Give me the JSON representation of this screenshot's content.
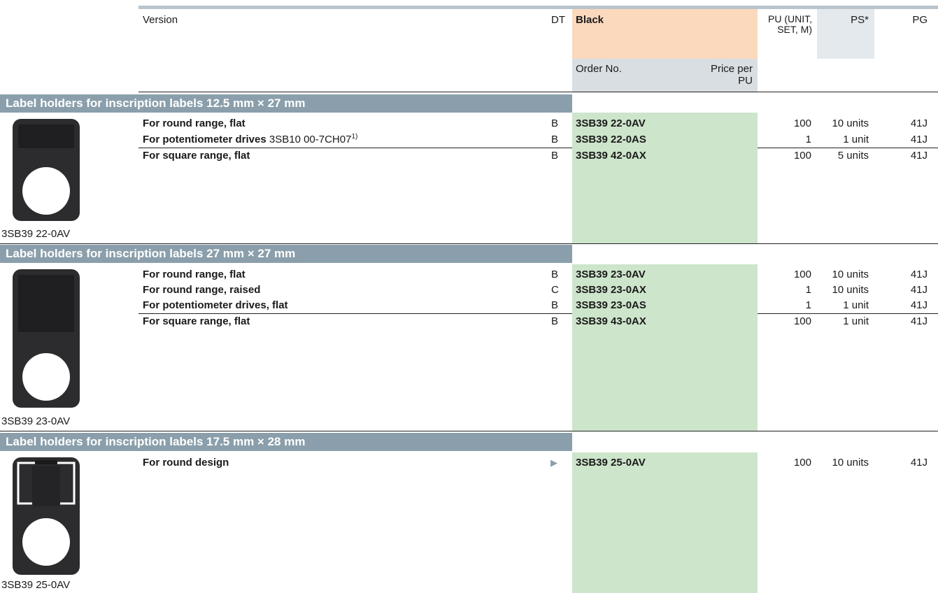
{
  "header": {
    "version": "Version",
    "dt": "DT",
    "color": "Black",
    "pu": "PU (UNIT, SET, M)",
    "ps": "PS*",
    "pg": "PG",
    "order_no": "Order No.",
    "price": "Price per PU"
  },
  "sections": [
    {
      "title": "Label holders for inscription labels 12.5 mm × 27 mm",
      "caption": "3SB39 22-0AV",
      "rows": [
        {
          "label": "For round range, flat",
          "suffix": "",
          "note": "",
          "dt": "B",
          "order": "3SB39 22-0AV",
          "pu": "100",
          "ps": "10 units",
          "pg": "41J"
        },
        {
          "label": "For potentiometer drives",
          "suffix": "3SB10 00-7CH07",
          "note": "1)",
          "dt": "B",
          "order": "3SB39 22-0AS",
          "pu": "1",
          "ps": "1 unit",
          "pg": "41J"
        },
        {
          "label": "For square range, flat",
          "suffix": "",
          "note": "",
          "dt": "B",
          "order": "3SB39 42-0AX",
          "pu": "100",
          "ps": "5 units",
          "pg": "41J"
        }
      ]
    },
    {
      "title": "Label holders for inscription labels 27 mm × 27 mm",
      "caption": "3SB39 23-0AV",
      "rows": [
        {
          "label": "For round range, flat",
          "dt": "B",
          "order": "3SB39 23-0AV",
          "pu": "100",
          "ps": "10 units",
          "pg": "41J"
        },
        {
          "label": "For round range, raised",
          "dt": "C",
          "order": "3SB39 23-0AX",
          "pu": "1",
          "ps": "10 units",
          "pg": "41J"
        },
        {
          "label": "For potentiometer drives, flat",
          "dt": "B",
          "order": "3SB39 23-0AS",
          "pu": "1",
          "ps": "1 unit",
          "pg": "41J"
        },
        {
          "label": "For square range, flat",
          "dt": "B",
          "order": "3SB39 43-0AX",
          "pu": "100",
          "ps": "1 unit",
          "pg": "41J"
        }
      ]
    },
    {
      "title": "Label holders for inscription labels 17.5 mm × 28 mm",
      "caption": "3SB39 25-0AV",
      "rows": [
        {
          "label": "For round design",
          "dt_symbol": "▶",
          "order": "3SB39 25-0AV",
          "pu": "100",
          "ps": "10 units",
          "pg": "41J"
        }
      ]
    }
  ],
  "colors": {
    "section_bar": "#8a9fab",
    "order_column": "#cde5cb",
    "black_header": "#fbd9bd"
  }
}
